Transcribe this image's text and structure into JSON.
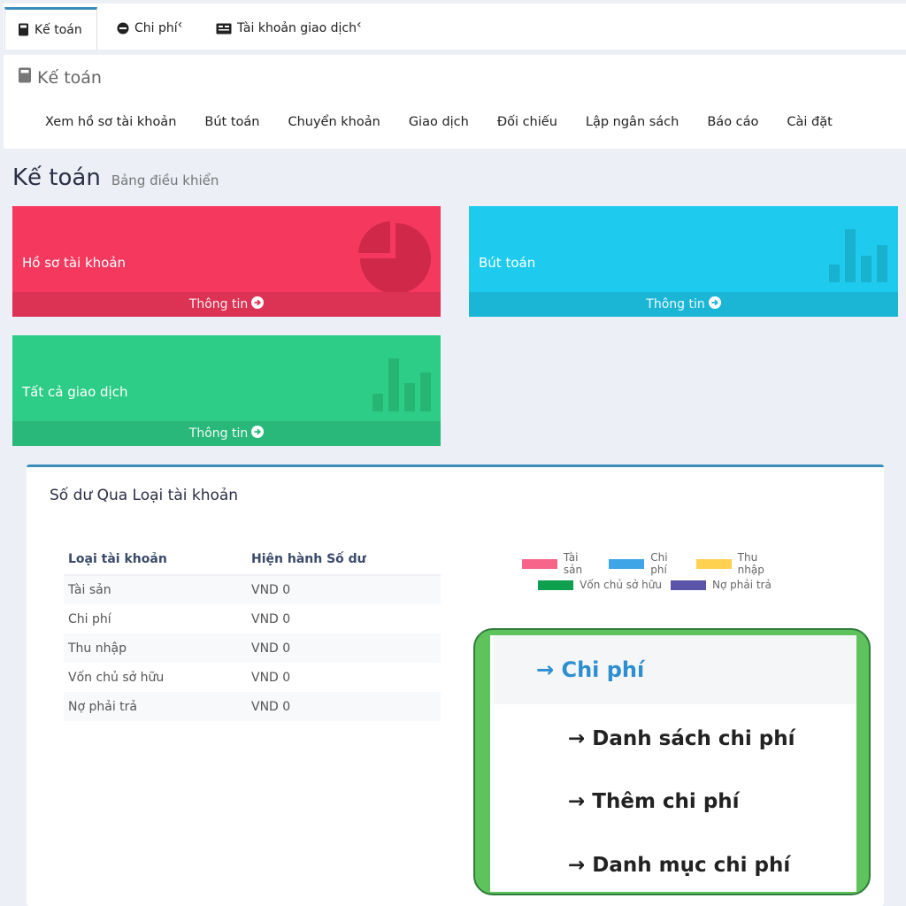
{
  "top_tabs": [
    {
      "label": "Kế toán",
      "icon": "book-icon",
      "active": true
    },
    {
      "label": "Chi phí",
      "icon": "minus-circle-icon",
      "arrow": "‹"
    },
    {
      "label": "Tài khoản giao dịch",
      "icon": "id-card-icon",
      "arrow": "‹"
    }
  ],
  "module": {
    "title": "Kế toán",
    "menu": [
      "Xem hồ sơ tài khoản",
      "Bút toán",
      "Chuyển khoản",
      "Giao dịch",
      "Đối chiếu",
      "Lập ngân sách",
      "Báo cáo",
      "Cài đặt"
    ]
  },
  "page": {
    "title": "Kế toán",
    "subtitle": "Bảng điều khiển"
  },
  "cards": [
    {
      "label": "Hồ sơ tài khoản",
      "footer": "Thông tin",
      "color": "#f5385e",
      "icon": "pie-chart-icon"
    },
    {
      "label": "Bút toán",
      "footer": "Thông tin",
      "color": "#1ecbee",
      "icon": "bar-chart-icon"
    },
    {
      "label": "Tất cả giao dịch",
      "footer": "Thông tin",
      "color": "#2ecd87",
      "icon": "bar-chart-icon"
    }
  ],
  "balance": {
    "title": "Số dư Qua Loại tài khoản",
    "headers": [
      "Loại tài khoản",
      "Hiện hành Số dư"
    ],
    "rows": [
      [
        "Tài sản",
        "VND 0"
      ],
      [
        "Chi phí",
        "VND 0"
      ],
      [
        "Thu nhập",
        "VND 0"
      ],
      [
        "Vốn chủ sở hữu",
        "VND 0"
      ],
      [
        "Nợ phải trả",
        "VND 0"
      ]
    ],
    "legend": [
      {
        "label": "Tài sản",
        "color": "#f7658a"
      },
      {
        "label": "Chi phí",
        "color": "#3ea6e6"
      },
      {
        "label": "Thu nhập",
        "color": "#ffd150"
      },
      {
        "label": "Vốn chủ sở hữu",
        "color": "#0e9f4f"
      },
      {
        "label": "Nợ phải trả",
        "color": "#5b54a8"
      }
    ]
  },
  "dropdown": {
    "head": "→ Chi phí",
    "items": [
      "→ Danh sách chi phí",
      "→ Thêm chi phí",
      "→ Danh mục chi phí"
    ]
  }
}
